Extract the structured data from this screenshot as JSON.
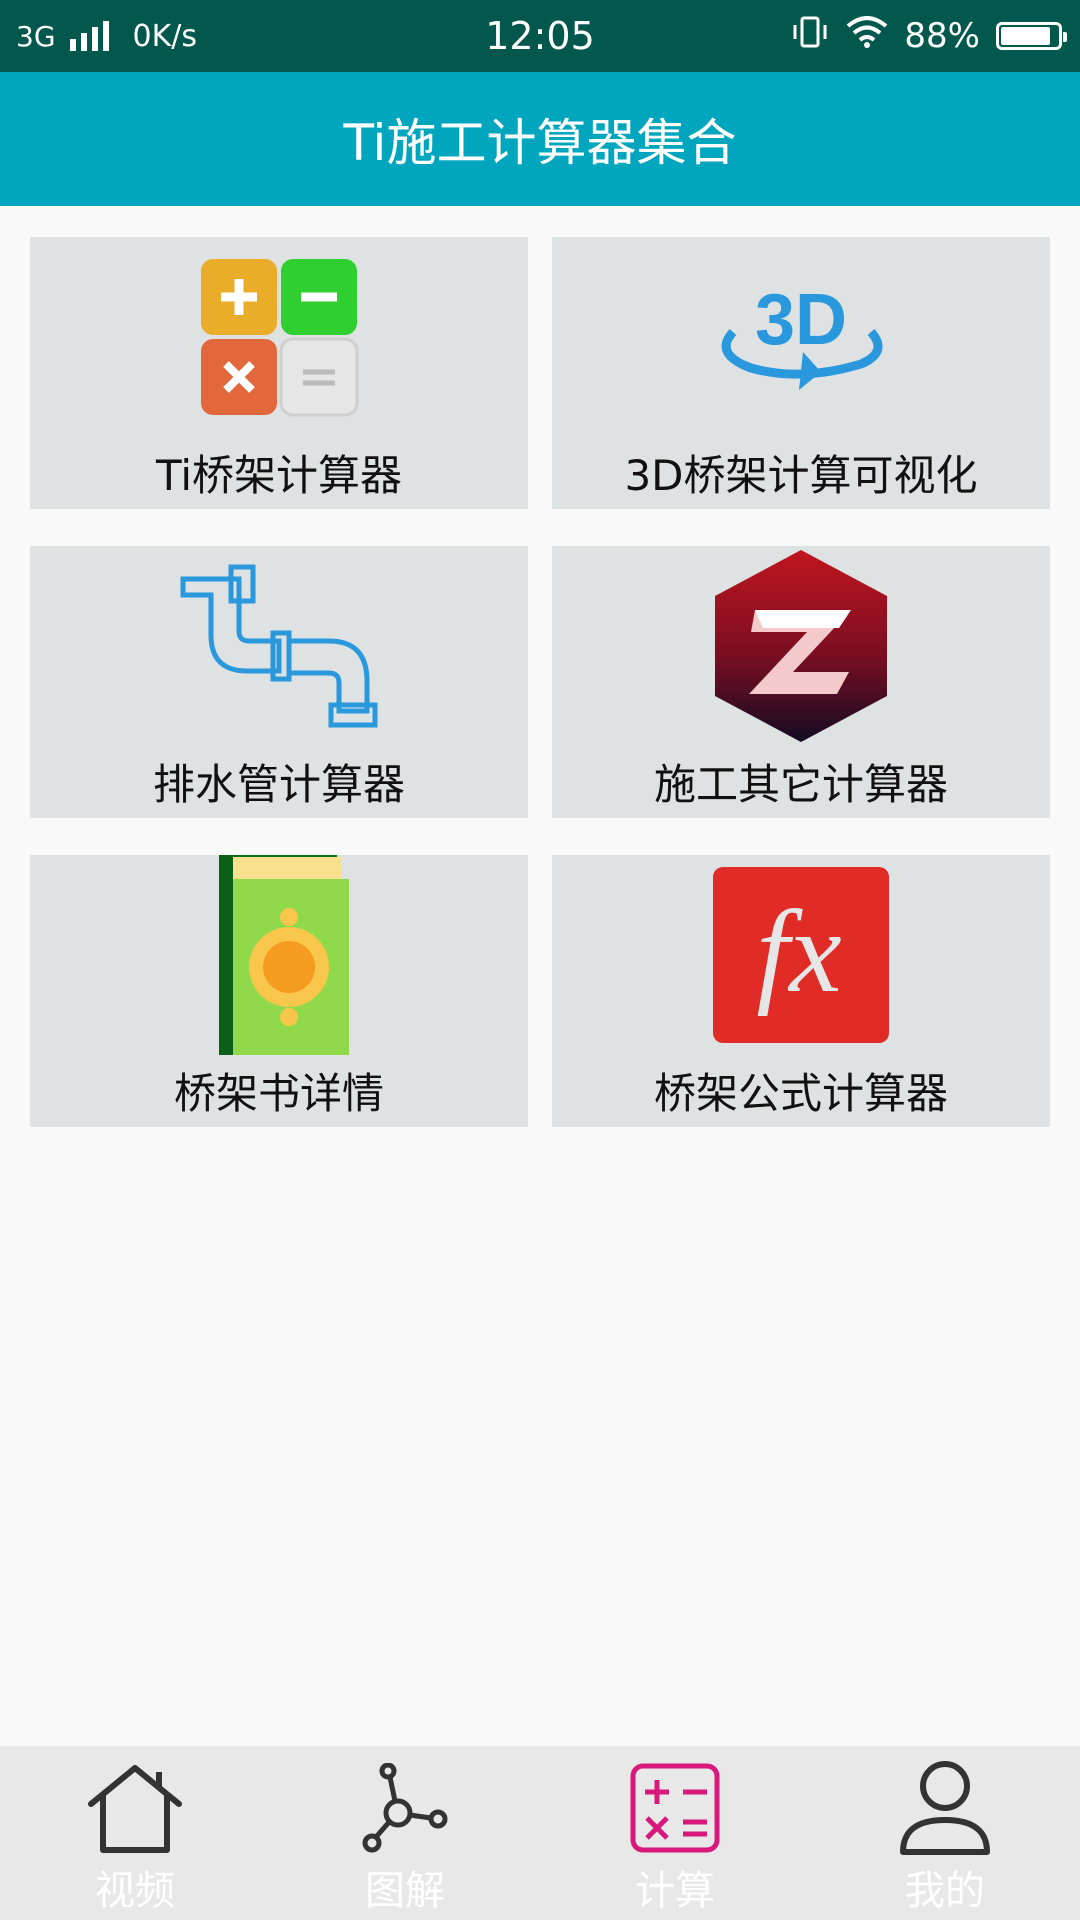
{
  "status_bar": {
    "network": "3G",
    "speed": "0K/s",
    "time": "12:05",
    "battery_percent": "88%",
    "battery_level": 0.88
  },
  "app_bar": {
    "title": "Ti施工计算器集合"
  },
  "cards": [
    {
      "label": "Ti桥架计算器",
      "icon": "calculator-icon"
    },
    {
      "label": "3D桥架计算可视化",
      "icon": "3d-rotate-icon"
    },
    {
      "label": "排水管计算器",
      "icon": "pipe-icon"
    },
    {
      "label": "施工其它计算器",
      "icon": "z-hexagon-icon"
    },
    {
      "label": "桥架书详情",
      "icon": "book-icon"
    },
    {
      "label": "桥架公式计算器",
      "icon": "fx-formula-icon"
    }
  ],
  "bottom_nav": {
    "items": [
      {
        "label": "视频",
        "icon": "home-icon"
      },
      {
        "label": "图解",
        "icon": "graph-nodes-icon"
      },
      {
        "label": "计算",
        "icon": "calculator-outline-icon",
        "active": true
      },
      {
        "label": "我的",
        "icon": "person-icon"
      }
    ],
    "active_color": "#d6197a",
    "inactive_color": "#333333"
  },
  "colors": {
    "status_bar": "#02584c",
    "app_bar": "#00a6bd",
    "card": "#dfe2e3"
  }
}
